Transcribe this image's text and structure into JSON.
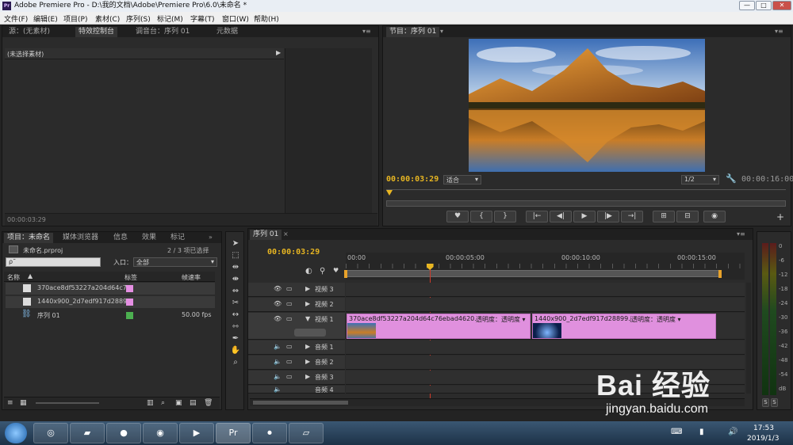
{
  "window": {
    "title": "Adobe Premiere Pro - D:\\我的文档\\Adobe\\Premiere Pro\\6.0\\未命名 *",
    "icon_text": "Pr",
    "controls": [
      "—",
      "□",
      "✕"
    ]
  },
  "menu": [
    "文件(F)",
    "编辑(E)",
    "项目(P)",
    "素材(C)",
    "序列(S)",
    "标记(M)",
    "字幕(T)",
    "窗口(W)",
    "帮助(H)"
  ],
  "source_panel": {
    "tabs": [
      "源：(无素材)",
      "特效控制台",
      "调音台：序列 01",
      "元数据"
    ],
    "active_tab": 1,
    "header": "(未选择素材)",
    "footer_timecode": "00:00:03:29"
  },
  "program_panel": {
    "tab": "节目：序列 01",
    "timecode": "00:00:03:29",
    "fit": "适合",
    "resolution": "1/2",
    "duration": "00:00:16:00",
    "transport_buttons": [
      "♥",
      "{",
      "}",
      "|←",
      "◀|",
      "▶",
      "|▶",
      "→|",
      "⊞",
      "⊟",
      "◉"
    ],
    "add_button": "+"
  },
  "project_panel": {
    "tabs": [
      "项目：未命名",
      "媒体浏览器",
      "信息",
      "效果",
      "标记"
    ],
    "project_file": "未命名.prproj",
    "selection": "2 / 3 项已选择",
    "search_placeholder": "ρ˜",
    "inpoint_label": "入口：",
    "inpoint_value": "全部",
    "columns": [
      "名称",
      "标签",
      "帧速率"
    ],
    "items": [
      {
        "name": "370ace8df53227a204d64c7",
        "fps": "",
        "color": "#e58fe3"
      },
      {
        "name": "1440x900_2d7edf917d28899",
        "fps": "",
        "color": "#e58fe3"
      },
      {
        "name": "序列 01",
        "fps": "50.00 fps",
        "color": "#4caf50"
      }
    ]
  },
  "timeline": {
    "tab": "序列 01",
    "timecode": "00:00:03:29",
    "ruler": [
      "00:00",
      "00:00:05:00",
      "00:00:10:00",
      "00:00:15:00"
    ],
    "playhead_seconds": 3.58,
    "duration_seconds": 16,
    "tracks": {
      "video": [
        "视频 3",
        "视频 2",
        "视频 1"
      ],
      "audio": [
        "音频 1",
        "音频 2",
        "音频 3",
        "音频 4"
      ]
    },
    "clips": [
      {
        "name": "370ace8df53227a204d64c76ebad4620.jpg",
        "fx": "透明度：透明度 ▾"
      },
      {
        "name": "1440x900_2d7edf917d28899.jpg",
        "fx": "透明度：透明度 ▾"
      }
    ]
  },
  "meter": {
    "labels": [
      "0",
      "-6",
      "-12",
      "-18",
      "-24",
      "-30",
      "-36",
      "-42",
      "-48",
      "-54",
      "dB"
    ],
    "solo": [
      "S",
      "S"
    ]
  },
  "taskbar": {
    "time": "17:53",
    "date": "2019/1/3",
    "apps": [
      "start",
      "ie",
      "folder",
      "qq",
      "firefox",
      "camtasia",
      "premiere",
      "record",
      "notes"
    ]
  },
  "watermark": {
    "brand": "Bai 经验",
    "url": "jingyan.baidu.com"
  }
}
